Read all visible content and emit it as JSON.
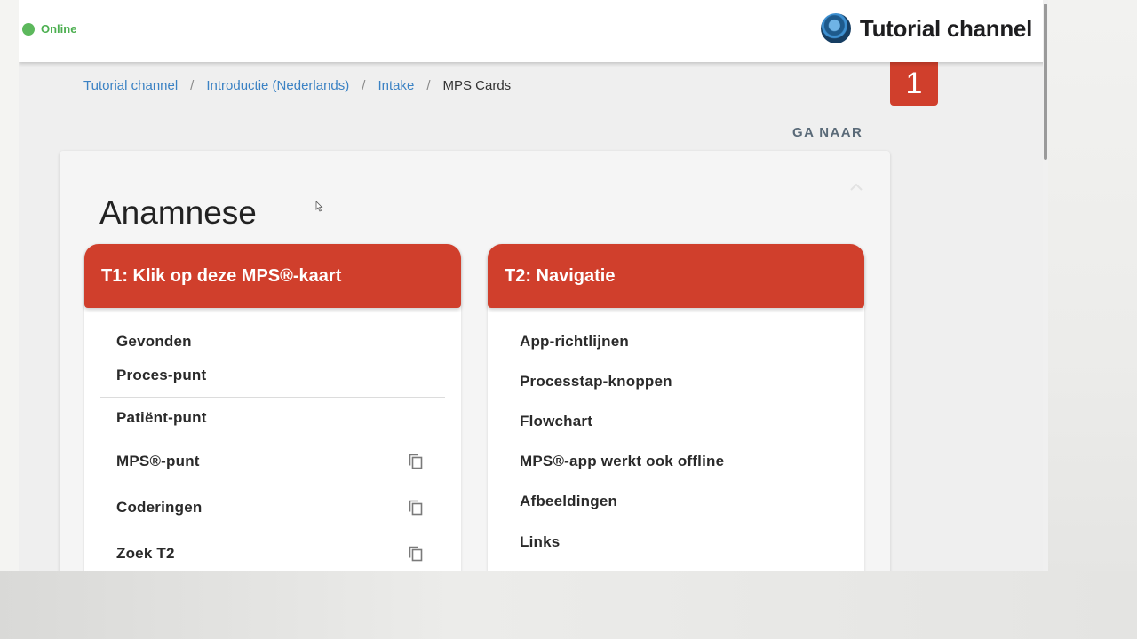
{
  "status": {
    "label": "Online",
    "color": "#4caf50"
  },
  "brand": {
    "name": "Tutorial channel",
    "logo": "logo-icon"
  },
  "breadcrumb": [
    {
      "label": "Tutorial channel"
    },
    {
      "label": "Introductie (Nederlands)"
    },
    {
      "label": "Intake"
    },
    {
      "label": "MPS Cards"
    }
  ],
  "breadcrumb_separator": "/",
  "step_badge": "1",
  "goto_label": "GA NAAR",
  "panel": {
    "title": "Anamnese"
  },
  "cards": [
    {
      "title": "T1: Klik op deze MPS®-kaart",
      "items": [
        {
          "label": "Gevonden"
        },
        {
          "label": "Proces-punt"
        },
        {
          "label": "Patiënt-punt"
        },
        {
          "label": "MPS®-punt",
          "icon": "copy-icon"
        },
        {
          "label": "Coderingen",
          "icon": "copy-icon"
        },
        {
          "label": "Zoek T2",
          "icon": "copy-icon"
        }
      ]
    },
    {
      "title": "T2: Navigatie",
      "items": [
        {
          "label": "App-richtlijnen"
        },
        {
          "label": "Processtap-knoppen"
        },
        {
          "label": "Flowchart"
        },
        {
          "label": "MPS®-app werkt ook offline"
        },
        {
          "label": "Afbeeldingen"
        },
        {
          "label": "Links"
        }
      ]
    }
  ],
  "colors": {
    "accent": "#d03f2c",
    "link": "#3b82c4"
  }
}
